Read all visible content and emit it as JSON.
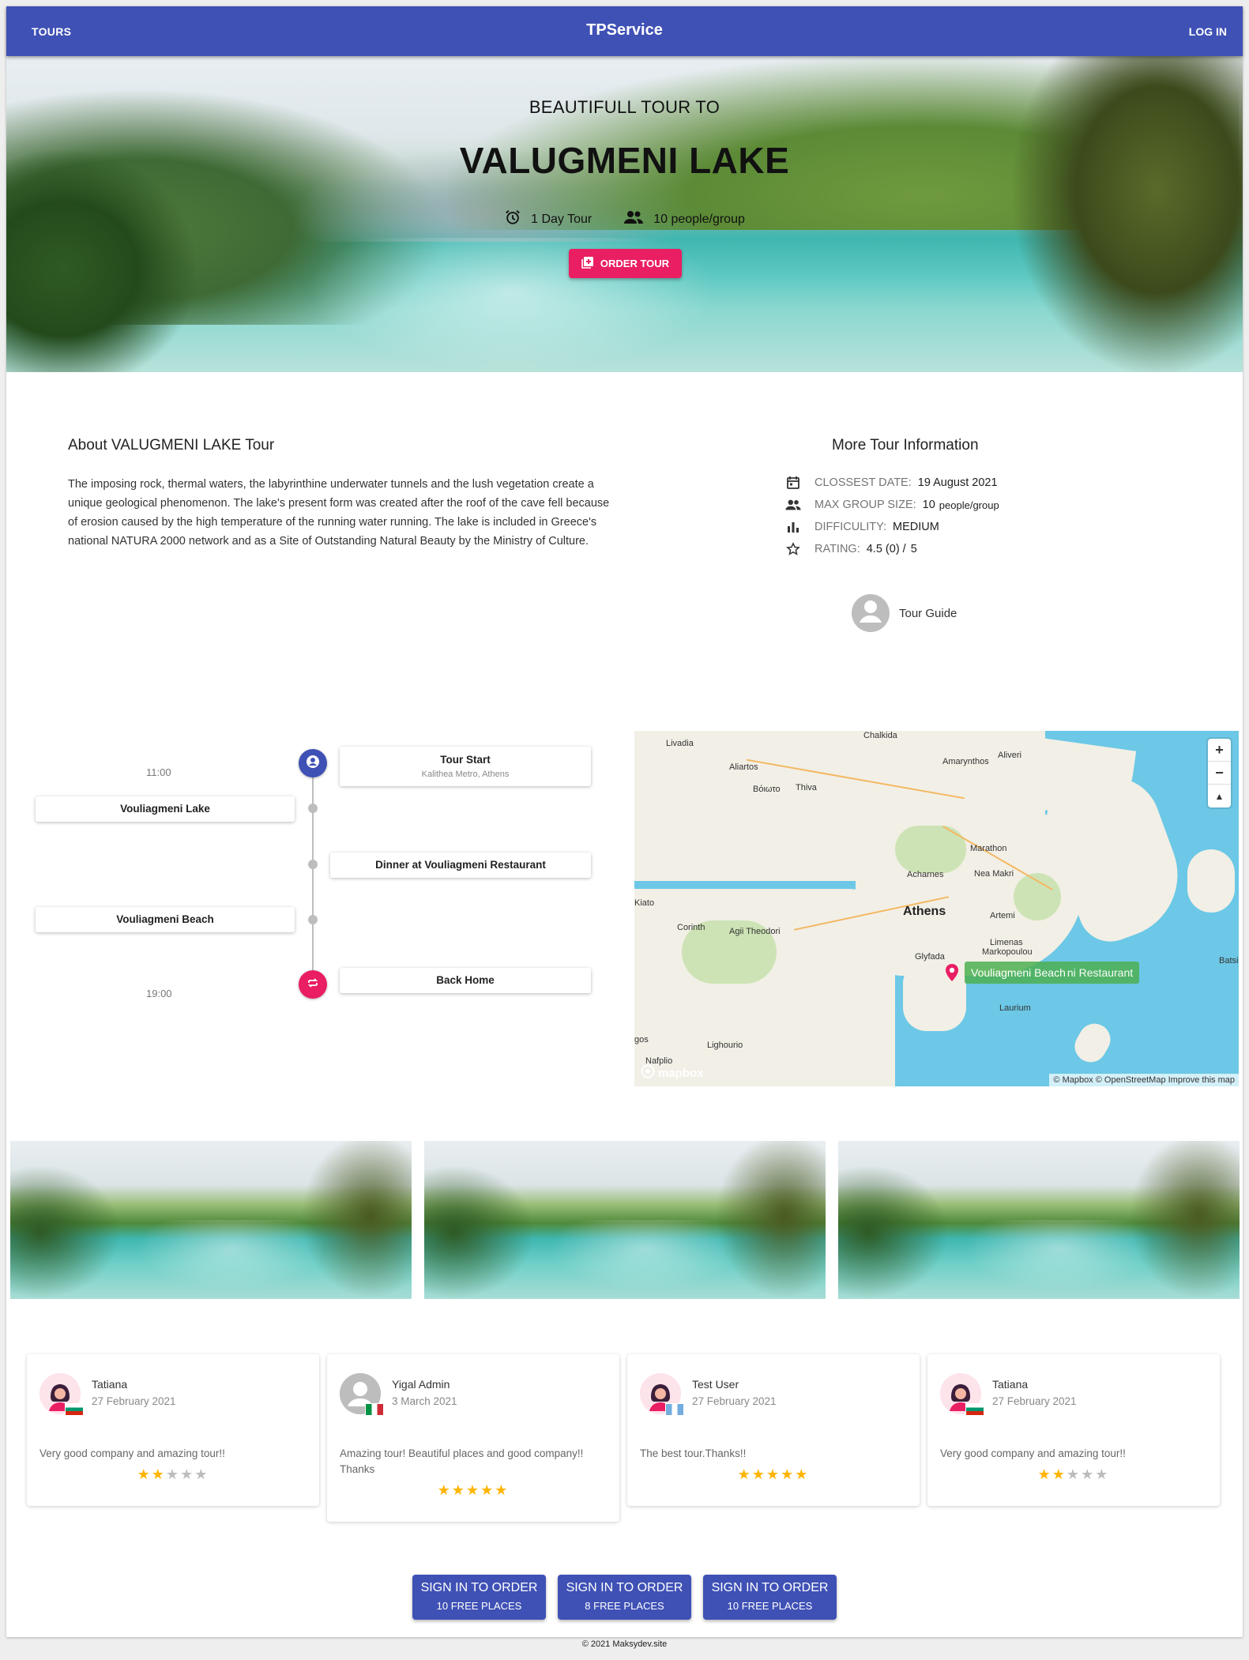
{
  "appbar": {
    "tours": "TOURS",
    "brand": "TPService",
    "login": "LOG IN"
  },
  "hero": {
    "subtitle": "BEAUTIFULL TOUR TO",
    "title": "VALUGMENI LAKE",
    "duration": "1 Day Tour",
    "group": "10 people/group",
    "order_label": "ORDER TOUR"
  },
  "about": {
    "title": "About VALUGMENI LAKE Tour",
    "text": "The imposing rock, thermal waters, the labyrinthine underwater tunnels and the lush vegetation create a unique geological phenomenon. The lake's present form was created after the roof of the cave fell because of erosion caused by the high temperature of the running water running. The lake is included in Greece's national NATURA 2000 network and as a Site of Outstanding Natural Beauty by the Ministry of Culture."
  },
  "info": {
    "title": "More Tour Information",
    "closest_label": "CLOSSEST DATE:",
    "closest_value": "19 August 2021",
    "group_label": "MAX GROUP SIZE:",
    "group_value": "10",
    "group_unit": "people/group",
    "difficulty_label": "DIFFICULITY:",
    "difficulty_value": "MEDIUM",
    "rating_label": "RATING:",
    "rating_value": "4.5 (0) /",
    "rating_max": "5",
    "guide": "Tour Guide"
  },
  "timeline": {
    "start_time": "11:00",
    "end_time": "19:00",
    "start_title": "Tour Start",
    "start_sub": "Kalithea Metro, Athens",
    "stop1": "Vouliagmeni Lake",
    "stop2": "Dinner at Vouliagmeni Restaurant",
    "stop3": "Vouliagmeni Beach",
    "end_title": "Back Home"
  },
  "map": {
    "labels": {
      "chalkida": "Chalkida",
      "livadia": "Livadia",
      "aliartos": "Aliartos",
      "voyio": "Βόιωτο",
      "thiva": "Thiva",
      "amarynthos": "Amarynthos",
      "aliveri": "Aliveri",
      "marathon": "Marathon",
      "acharnes": "Acharnes",
      "nea_makri": "Nea Makri",
      "athens": "Athens",
      "artemi": "Artemi",
      "corinth": "Corinth",
      "agii_theodori": "Agii Theodori",
      "glyfada": "Glyfada",
      "limenas": "Limenas",
      "markopoulou": "Markopoulou",
      "laurium": "Laurium",
      "lighourio": "Lighourio",
      "nafplio": "Nafplio",
      "kiato": "Kiato",
      "batsi": "Batsi",
      "gos": "gos"
    },
    "popup": "Vouliagmeni Beach",
    "popup_tail": "ni Restaurant",
    "zoom_in": "+",
    "zoom_out": "−",
    "compass": "▲",
    "attribution": "© Mapbox © OpenStreetMap Improve this map",
    "logo": "mapbox"
  },
  "reviews": [
    {
      "name": "Tatiana",
      "date": "27 February 2021",
      "text": "Very good company and amazing tour!!",
      "rating": 2
    },
    {
      "name": "Yigal Admin",
      "date": "3 March 2021",
      "text": "Amazing tour! Beautiful places and good company!! Thanks",
      "rating": 5
    },
    {
      "name": "Test User",
      "date": "27 February 2021",
      "text": "The best tour.Thanks!!",
      "rating": 5
    },
    {
      "name": "Tatiana",
      "date": "27 February 2021",
      "text": "Very good company and amazing tour!!",
      "rating": 2
    }
  ],
  "signin": [
    {
      "line1": "SIGN IN TO ORDER",
      "line2": "10  FREE PLACES"
    },
    {
      "line1": "SIGN IN TO ORDER",
      "line2": "8  FREE PLACES"
    },
    {
      "line1": "SIGN IN TO ORDER",
      "line2": "10  FREE PLACES"
    }
  ],
  "footer": "© 2021 Maksydev.site",
  "colors": {
    "primary": "#3f51b5",
    "accent": "#e91e63",
    "star": "#ffb400"
  }
}
